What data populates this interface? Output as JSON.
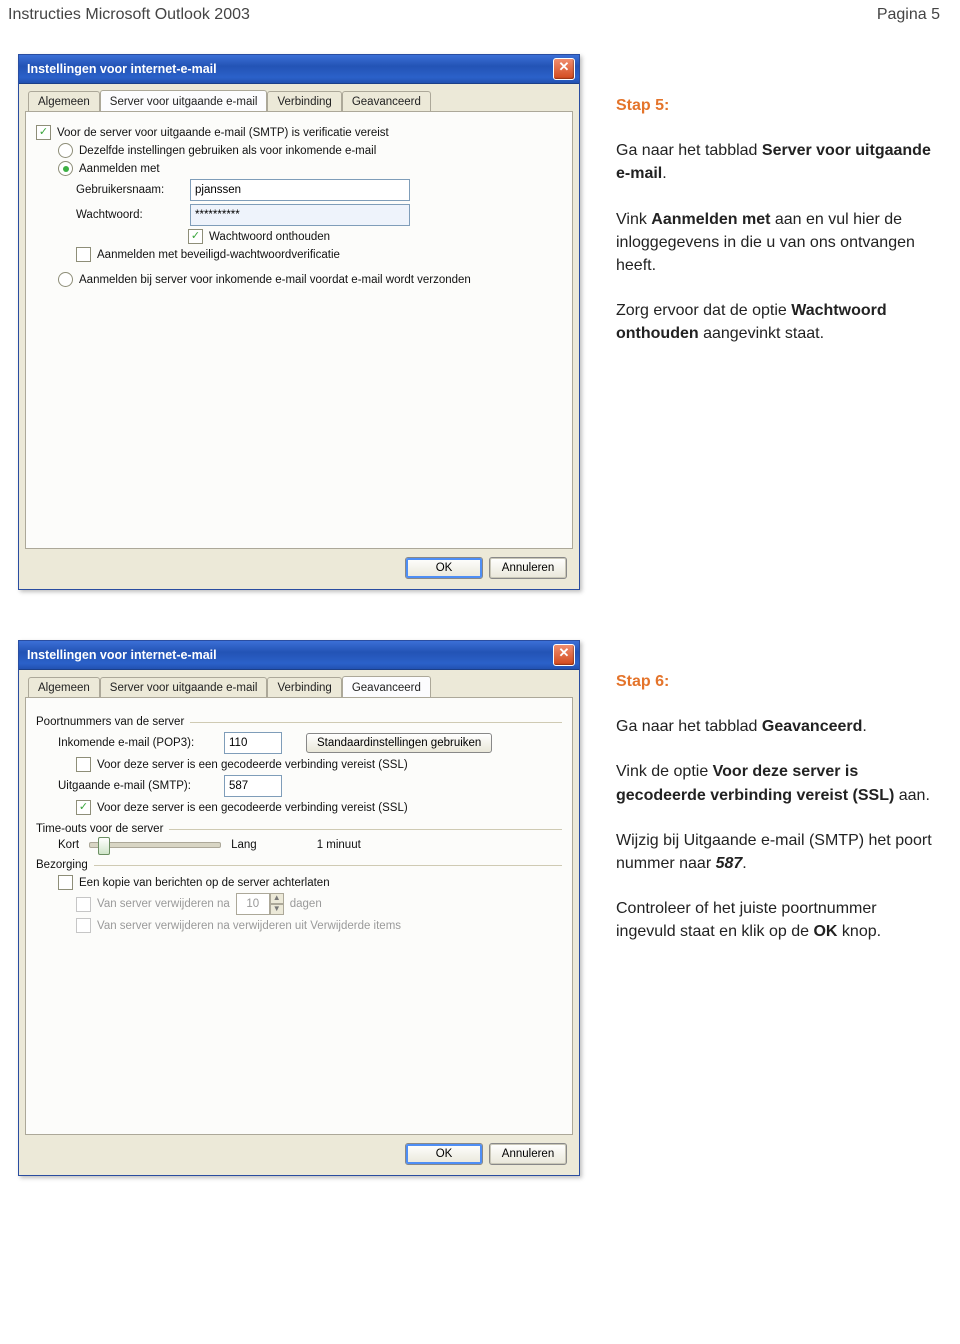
{
  "header": {
    "title": "Instructies Microsoft Outlook 2003",
    "page": "Pagina 5"
  },
  "dialog1": {
    "title": "Instellingen voor internet-e-mail",
    "tabs": [
      "Algemeen",
      "Server voor uitgaande e-mail",
      "Verbinding",
      "Geavanceerd"
    ],
    "active_tab": 1,
    "chk_verify": "Voor de server voor uitgaande e-mail (SMTP) is verificatie vereist",
    "rad_same": "Dezelfde instellingen gebruiken als voor inkomende e-mail",
    "rad_login": "Aanmelden met",
    "lbl_user": "Gebruikersnaam:",
    "val_user": "pjanssen",
    "lbl_pass": "Wachtwoord:",
    "val_pass": "**********",
    "chk_remember": "Wachtwoord onthouden",
    "chk_spa": "Aanmelden met beveiligd-wachtwoordverificatie",
    "rad_before": "Aanmelden bij server voor inkomende e-mail voordat e-mail wordt verzonden",
    "btn_ok": "OK",
    "btn_cancel": "Annuleren"
  },
  "step5": {
    "title": "Stap 5:",
    "p1a": "Ga naar het tabblad ",
    "p1b": "Server voor uitgaande e-mail",
    "p1c": ".",
    "p2a": "Vink ",
    "p2b": "Aanmelden met",
    "p2c": " aan en vul hier de inloggegevens in die u van ons ontvangen heeft.",
    "p3a": "Zorg ervoor dat de optie ",
    "p3b": "Wachtwoord onthouden",
    "p3c": " aangevinkt staat."
  },
  "dialog2": {
    "title": "Instellingen voor internet-e-mail",
    "tabs": [
      "Algemeen",
      "Server voor uitgaande e-mail",
      "Verbinding",
      "Geavanceerd"
    ],
    "active_tab": 3,
    "grp_ports": "Poortnummers van de server",
    "lbl_pop": "Inkomende e-mail (POP3):",
    "val_pop": "110",
    "btn_defaults": "Standaardinstellingen gebruiken",
    "chk_ssl_in": "Voor deze server is een gecodeerde verbinding vereist (SSL)",
    "lbl_smtp": "Uitgaande e-mail (SMTP):",
    "val_smtp": "587",
    "chk_ssl_out": "Voor deze server is een gecodeerde verbinding vereist (SSL)",
    "grp_timeout": "Time-outs voor de server",
    "lbl_short": "Kort",
    "lbl_long": "Lang",
    "lbl_minute": "1 minuut",
    "grp_delivery": "Bezorging",
    "chk_leave": "Een kopie van berichten op de server achterlaten",
    "lbl_remove_after_a": "Van server verwijderen na",
    "lbl_remove_after_b": "dagen",
    "val_days": "10",
    "lbl_remove_deleted": "Van server verwijderen na verwijderen uit Verwijderde items",
    "btn_ok": "OK",
    "btn_cancel": "Annuleren"
  },
  "step6": {
    "title": "Stap 6:",
    "p1a": "Ga naar het tabblad ",
    "p1b": "Geavanceerd",
    "p1c": ".",
    "p2a": "Vink de optie ",
    "p2b": "Voor deze server is gecodeerde verbinding vereist (SSL)",
    "p2c": " aan.",
    "p3a": "Wijzig bij Uitgaande e-mail (SMTP) het poort nummer naar ",
    "p3b": "587",
    "p3c": ".",
    "p4a": "Controleer of het juiste poortnummer ingevuld staat en klik op de ",
    "p4b": "OK",
    "p4c": " knop."
  }
}
